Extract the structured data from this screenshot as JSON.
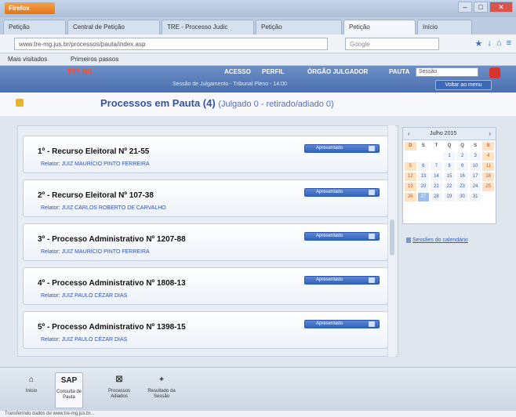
{
  "browser": {
    "app_button": "Firefox",
    "tabs": [
      "Petição",
      "Central de Petição",
      "TRE - Processo Judic",
      "Petição",
      "Petição",
      "Início"
    ],
    "url": "www.tre-mg.jus.br/processos/pauta/index.asp",
    "search_placeholder": "Google",
    "bookmarks": [
      "Mais visitados",
      "Primeiros passos"
    ]
  },
  "app_header": {
    "logo": "TRE-MG",
    "fields": [
      "ACESSO",
      "PERFIL",
      "ÓRGÃO JULGADOR",
      "PAUTA"
    ],
    "select_value": "Sessão",
    "subline": "Sessão de Julgamento - Tribunal Pleno - 14:00",
    "top_button": "Voltar ao menu"
  },
  "page": {
    "title": "Processos em Pauta (4)",
    "subtitle": "(Julgado 0 - retirado/adiado 0)"
  },
  "cases": [
    {
      "title": "1º - Recurso Eleitoral Nº 21-55",
      "relator": "Relator: JUIZ MAURÍCIO PINTO FERREIRA",
      "button": "Apresentado"
    },
    {
      "title": "2º - Recurso Eleitoral Nº 107-38",
      "relator": "Relator: JUIZ CARLOS ROBERTO DE CARVALHO",
      "button": "Apresentado"
    },
    {
      "title": "3º - Processo Administrativo Nº 1207-88",
      "relator": "Relator: JUIZ MAURÍCIO PINTO FERREIRA",
      "button": "Apresentado"
    },
    {
      "title": "4º - Processo Administrativo Nº 1808-13",
      "relator": "Relator: JUIZ PAULO CÉZAR DIAS",
      "button": "Apresentado"
    },
    {
      "title": "5º - Processo Administrativo Nº 1398-15",
      "relator": "Relator: JUIZ PAULO CÉZAR DIAS",
      "button": "Apresentado"
    }
  ],
  "calendar": {
    "prev": "‹",
    "next": "›",
    "month": "Julho 2015",
    "day_headers": [
      "D",
      "S",
      "T",
      "Q",
      "Q",
      "S",
      "S"
    ],
    "days": [
      "",
      "",
      "",
      "1",
      "2",
      "3",
      "4",
      "5",
      "6",
      "7",
      "8",
      "9",
      "10",
      "11",
      "12",
      "13",
      "14",
      "15",
      "16",
      "17",
      "18",
      "19",
      "20",
      "21",
      "22",
      "23",
      "24",
      "25",
      "26",
      "27",
      "28",
      "29",
      "30",
      "31",
      ""
    ],
    "today": "27",
    "link": "Sessões do calendário"
  },
  "toolbar": [
    {
      "icon": "⌂",
      "label": "Início"
    },
    {
      "icon": "SAP",
      "label": "Consulta de Pauta"
    },
    {
      "icon": "☒",
      "label": "Processos Adiados"
    },
    {
      "icon": "+",
      "label": "Resultado da Sessão"
    }
  ],
  "status": "Transferindo dados de www.tre-mg.jus.br..."
}
